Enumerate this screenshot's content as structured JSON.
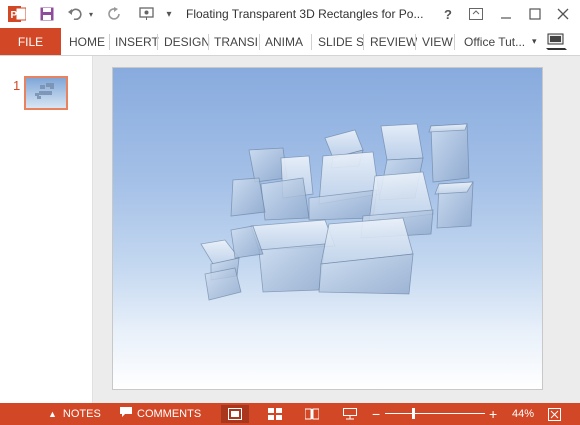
{
  "titlebar": {
    "title": "Floating Transparent 3D Rectangles for Po...",
    "help_label": "?",
    "app_icon_label": "P"
  },
  "ribbon": {
    "file_label": "FILE",
    "tabs": [
      "HOME",
      "INSERT",
      "DESIGN",
      "TRANSI",
      "ANIMA",
      "SLIDE S",
      "REVIEW",
      "VIEW"
    ],
    "account_label": "Office Tut..."
  },
  "thumbnails": [
    {
      "number": "1"
    }
  ],
  "statusbar": {
    "notes_label": "NOTES",
    "comments_label": "COMMENTS",
    "zoom_level": "44%",
    "zoom_fraction": 0.28
  },
  "colors": {
    "accent": "#d24726",
    "slide_top": "#88abde",
    "slide_bottom": "#ffffff"
  }
}
